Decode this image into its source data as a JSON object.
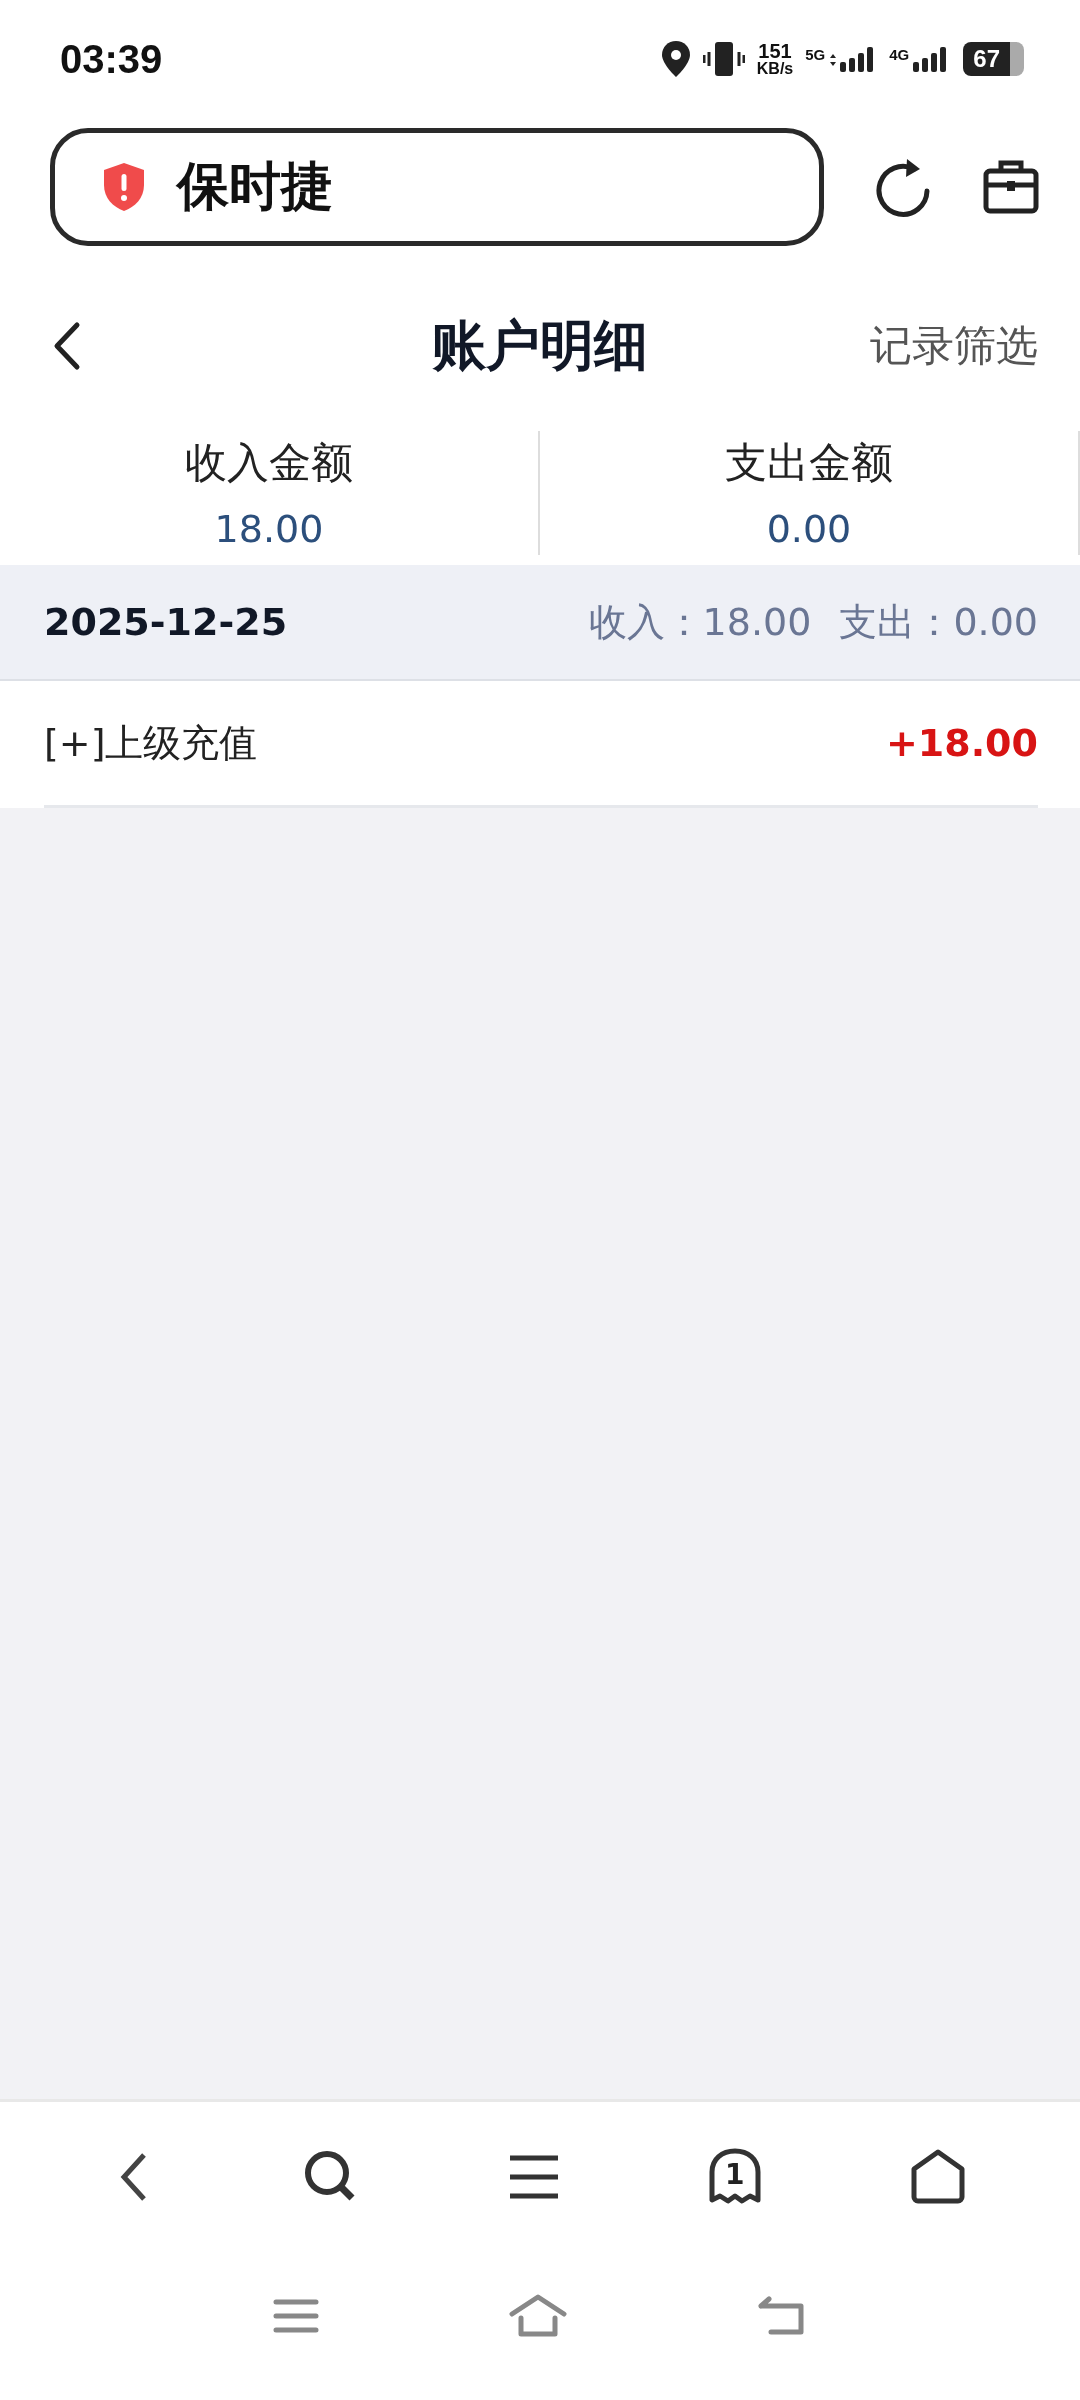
{
  "status_bar": {
    "time": "03:39",
    "net_speed": "151",
    "net_unit": "KB/s",
    "sim_1": "5G",
    "sim_2": "4G",
    "battery": "67"
  },
  "address_bar": {
    "text": "保时捷"
  },
  "header": {
    "title": "账户明细",
    "filter": "记录筛选"
  },
  "summary": [
    {
      "label": "收入金额",
      "value": "18.00"
    },
    {
      "label": "支出金额",
      "value": "0.00"
    }
  ],
  "groups": [
    {
      "date": "2025-12-25",
      "income": "收入：18.00",
      "expense": "支出：0.00",
      "records": [
        {
          "title": "[+]上级充值",
          "amount": "+18.00",
          "kind": "income"
        }
      ]
    }
  ],
  "bottom_bar": {
    "tab_count": "1"
  }
}
